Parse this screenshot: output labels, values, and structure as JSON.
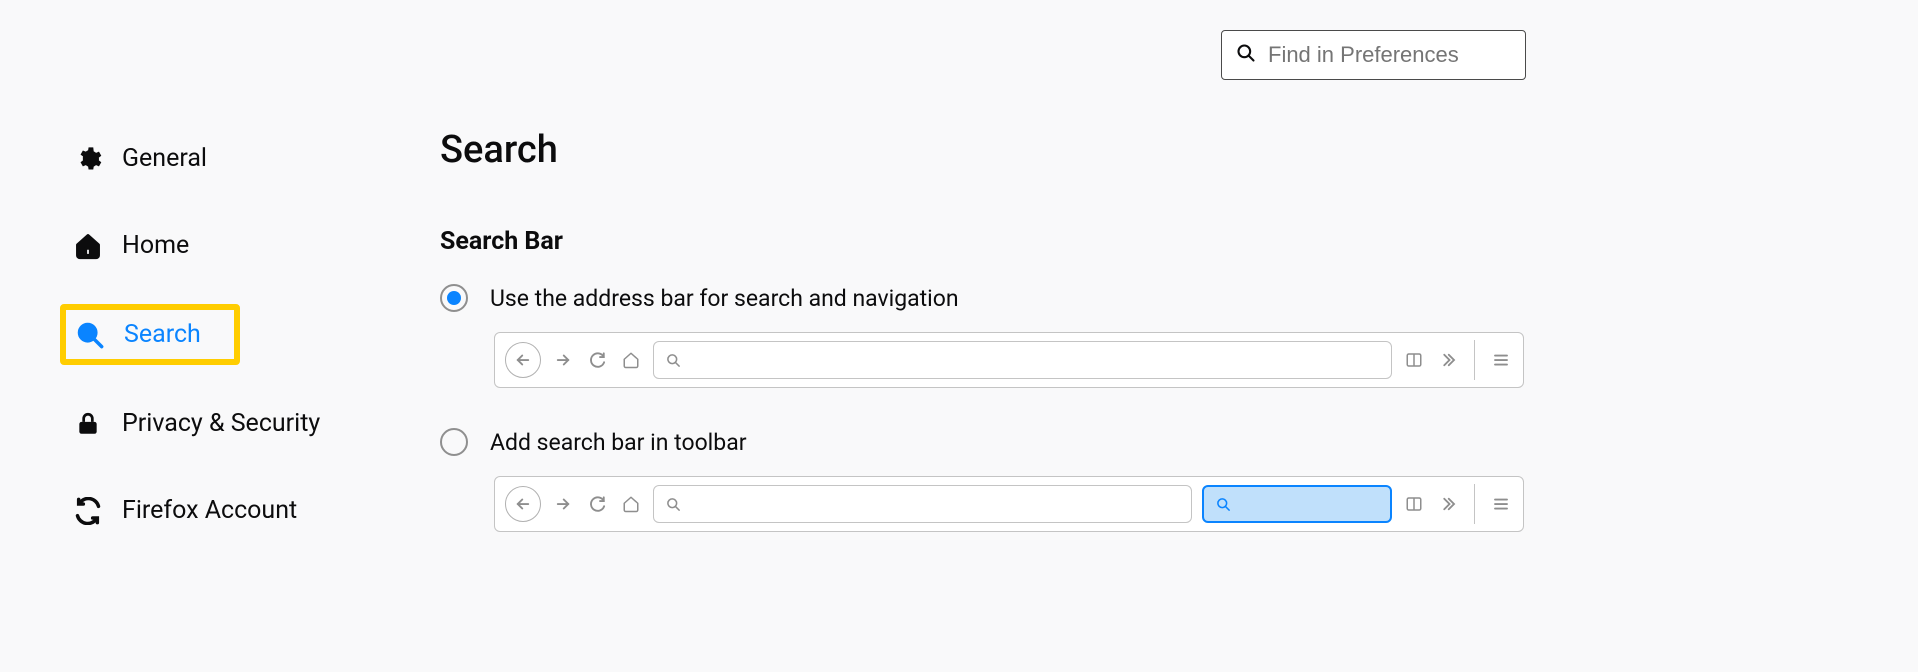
{
  "find": {
    "placeholder": "Find in Preferences"
  },
  "sidebar": {
    "items": [
      {
        "label": "General"
      },
      {
        "label": "Home"
      },
      {
        "label": "Search"
      },
      {
        "label": "Privacy & Security"
      },
      {
        "label": "Firefox Account"
      }
    ]
  },
  "main": {
    "title": "Search",
    "section_heading": "Search Bar",
    "options": [
      {
        "label": "Use the address bar for search and navigation"
      },
      {
        "label": "Add search bar in toolbar"
      }
    ]
  }
}
